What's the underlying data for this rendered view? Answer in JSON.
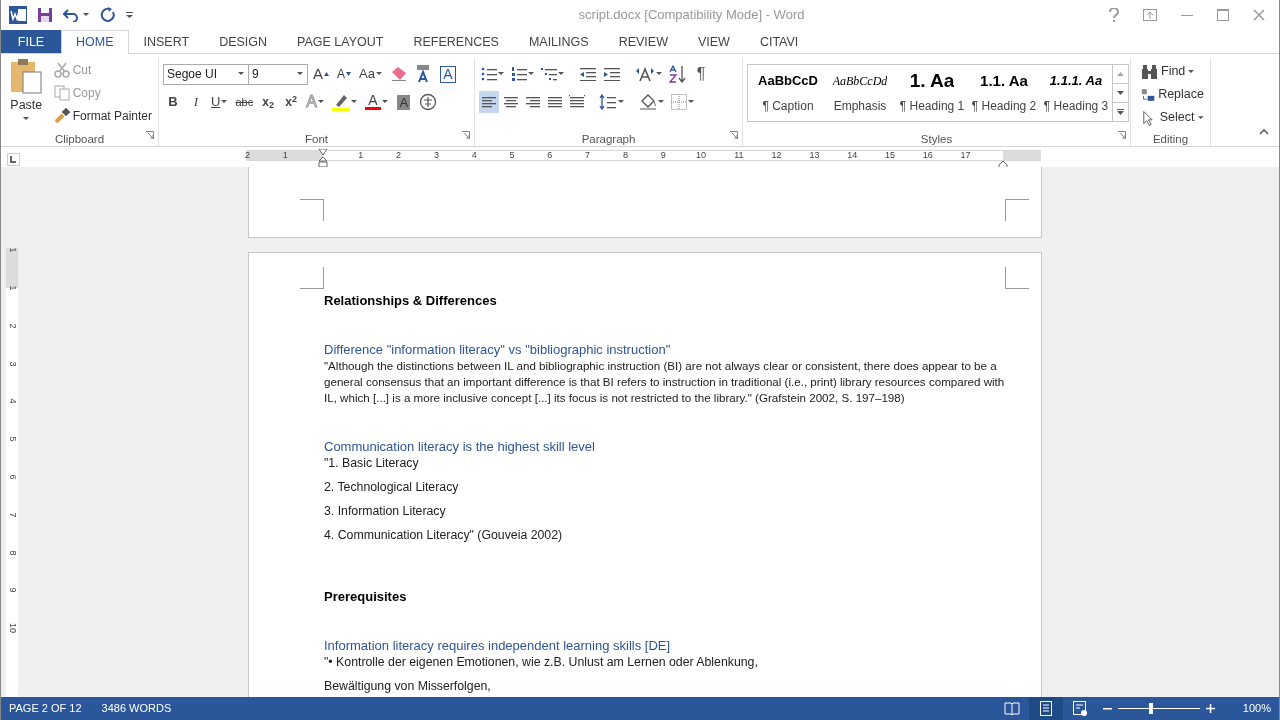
{
  "window": {
    "title": "script.docx [Compatibility Mode] - Word"
  },
  "tabs": [
    {
      "label": "FILE",
      "kind": "file",
      "selected": false
    },
    {
      "label": "HOME",
      "kind": "tab",
      "selected": true
    },
    {
      "label": "INSERT",
      "kind": "tab",
      "selected": false
    },
    {
      "label": "DESIGN",
      "kind": "tab",
      "selected": false
    },
    {
      "label": "PAGE LAYOUT",
      "kind": "tab",
      "selected": false
    },
    {
      "label": "REFERENCES",
      "kind": "tab",
      "selected": false
    },
    {
      "label": "MAILINGS",
      "kind": "tab",
      "selected": false
    },
    {
      "label": "REVIEW",
      "kind": "tab",
      "selected": false
    },
    {
      "label": "VIEW",
      "kind": "tab",
      "selected": false
    },
    {
      "label": "CITAVI",
      "kind": "tab",
      "selected": false
    }
  ],
  "clipboard": {
    "label": "Clipboard",
    "paste": "Paste",
    "items": [
      {
        "label": "Cut",
        "kind": "cut",
        "disabled": true
      },
      {
        "label": "Copy",
        "kind": "copy",
        "disabled": true
      },
      {
        "label": "Format Painter",
        "kind": "painter",
        "disabled": false
      }
    ]
  },
  "font": {
    "label": "Font",
    "font_name": "Segoe UI",
    "font_size": "9",
    "row1": [
      {
        "label": "A",
        "kind": "grow"
      },
      {
        "label": "A",
        "kind": "shrink"
      },
      {
        "label": "Aa",
        "kind": "case"
      },
      {
        "kind": "clear"
      },
      {
        "kind": "phonetic"
      },
      {
        "label": "A",
        "kind": "border"
      }
    ],
    "row2": [
      {
        "label": "B",
        "kind": "bold"
      },
      {
        "label": "I",
        "kind": "italic"
      },
      {
        "label": "U",
        "kind": "underline"
      },
      {
        "label": "abc",
        "kind": "strike"
      },
      {
        "label": "x$_{2}$",
        "kind": "sub"
      },
      {
        "label": "x$^{2}$",
        "kind": "sup"
      },
      {
        "label": "A",
        "kind": "effects"
      },
      {
        "kind": "highlight",
        "color": "#ffff00"
      },
      {
        "label": "A",
        "kind": "fontcolor",
        "color": "#ff0000"
      },
      {
        "label": "A",
        "kind": "shading"
      },
      {
        "kind": "enclose"
      }
    ]
  },
  "paragraph": {
    "label": "Paragraph",
    "show_marks": "¶",
    "align": [
      {
        "kind": "left",
        "selected": true
      },
      {
        "kind": "center",
        "selected": false
      },
      {
        "kind": "right",
        "selected": false
      },
      {
        "kind": "justify",
        "selected": false
      },
      {
        "kind": "distributed",
        "selected": false
      }
    ]
  },
  "styles": {
    "label": "Styles",
    "items": [
      {
        "preview": "AaBbCcD",
        "name": "¶ Caption",
        "kind": "caption"
      },
      {
        "preview": "AaBbCcDd",
        "name": "Emphasis",
        "kind": "emphasis"
      },
      {
        "preview": "1.  Aa",
        "name": "¶ Heading 1",
        "kind": "h1"
      },
      {
        "preview": "1.1.  Aa",
        "name": "¶ Heading 2",
        "kind": "h2"
      },
      {
        "preview": "1.1.1.  Aa",
        "name": "¶ Heading 3",
        "kind": "h3"
      }
    ]
  },
  "editing": {
    "label": "Editing",
    "items": [
      {
        "label": "Find",
        "kind": "find"
      },
      {
        "label": "Replace",
        "kind": "replace"
      },
      {
        "label": "Select",
        "kind": "select"
      }
    ]
  },
  "ruler": {
    "numbers": [
      "2",
      "1",
      "1",
      "2",
      "3",
      "4",
      "5",
      "6",
      "7",
      "8",
      "9",
      "10",
      "11",
      "12",
      "13",
      "14",
      "15",
      "16",
      "17"
    ]
  },
  "vertical_ruler": {
    "numbers": [
      "1",
      "1",
      "2",
      "3",
      "4",
      "5",
      "6",
      "7",
      "8",
      "9",
      "10"
    ]
  },
  "document": {
    "blocks": [
      {
        "kind": "heading",
        "text": "Relationships & Differences"
      },
      {
        "kind": "subheading",
        "text": "Difference \"information literacy\" vs \"bibliographic instruction\""
      },
      {
        "kind": "para",
        "text": "\"Although the distinctions between IL and bibliographic instruction (BI) are not always clear or consistent, there does appear to be a general consensus that an important difference is that BI refers to instruction in traditional (i.e., print) library resources compared with IL, which [...] is a more inclusive concept [...] its focus is not restricted to the library.\" (Grafstein 2002, S. 197–198)"
      },
      {
        "kind": "subheading",
        "text": "Communication literacy is the highest skill level"
      },
      {
        "kind": "item",
        "text": "\"1. Basic Literacy"
      },
      {
        "kind": "item",
        "text": "2. Technological Literacy"
      },
      {
        "kind": "item",
        "text": "3. Information Literacy"
      },
      {
        "kind": "item",
        "text": "4. Communication Literacy\" (Gouveia 2002)"
      },
      {
        "kind": "heading",
        "text": "Prerequisites"
      },
      {
        "kind": "subheading",
        "text": "Information literacy requires independent learning skills [DE]"
      },
      {
        "kind": "item",
        "text": "\"• Kontrolle der eigenen Emotionen, wie z.B. Unlust am Lernen oder Ablenkung,"
      },
      {
        "kind": "item",
        "text": "Bewältigung von Misserfolgen,"
      }
    ]
  },
  "status_bar": {
    "page": "PAGE 2 OF 12",
    "words": "3486 WORDS",
    "views": [
      {
        "kind": "read",
        "selected": false
      },
      {
        "kind": "print",
        "selected": true
      },
      {
        "kind": "web",
        "selected": false
      }
    ],
    "zoom": {
      "level": 0.4,
      "reading": "100%"
    }
  }
}
